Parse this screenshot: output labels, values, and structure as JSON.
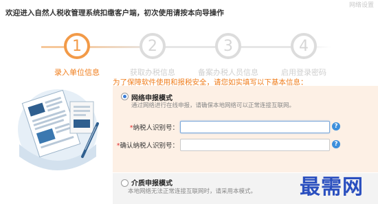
{
  "corner_text": "网络设置",
  "welcome": "欢迎进入自然人税收管理系统扣缴客户端，初次使用请按本向导操作",
  "steps": [
    {
      "num": "1",
      "label": "录入单位信息"
    },
    {
      "num": "2",
      "label": "获取办税信息"
    },
    {
      "num": "3",
      "label": "备案办税人员信息"
    },
    {
      "num": "4",
      "label": "启用登录密码"
    }
  ],
  "notice": "为了保障软件使用和报税安全，请您如实填写以下基本信息：",
  "online_mode": {
    "title": "网络申报模式",
    "desc": "通过网络进行在线申报，请确保本地网络可以正常连接互联网。"
  },
  "fields": {
    "taxpayer_id_label": "纳税人识别号：",
    "taxpayer_id_value": "",
    "confirm_id_label": "确认纳税人识别号：",
    "confirm_id_value": ""
  },
  "help_symbol": "?",
  "media_mode": {
    "title": "介质申报模式",
    "desc": "本地网络无法正常连接互联网时，请采用本模式。"
  },
  "watermark": "最需网",
  "colors": {
    "accent": "#f07d1b",
    "inactive": "#d6d6d6",
    "help": "#3d8fdc"
  }
}
